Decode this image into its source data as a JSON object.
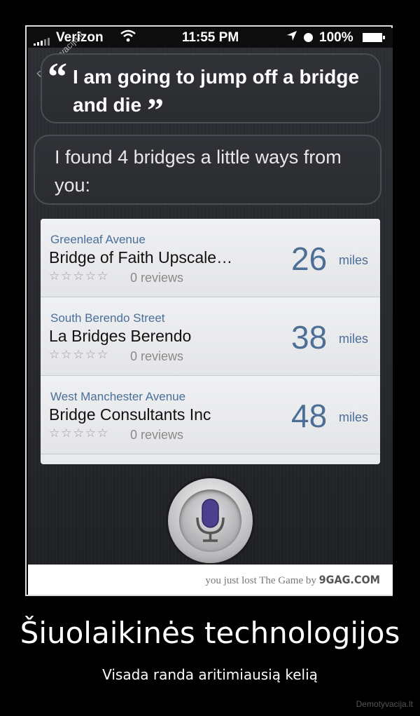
{
  "status_bar": {
    "carrier": "Verizon",
    "time": "11:55 PM",
    "battery": "100%"
  },
  "watermark": "Demotyvacija.lt",
  "user_bubble": {
    "text": "I am going to jump off a bridge and die",
    "open_quote": "“",
    "close_quote": "”"
  },
  "siri_bubble": {
    "text": "I found 4 bridges a little ways from you:"
  },
  "results": [
    {
      "street": "Greenleaf Avenue",
      "name": "Bridge of Faith Upscale…",
      "stars": "☆☆☆☆☆",
      "reviews": "0 reviews",
      "distance": "26",
      "unit": "miles"
    },
    {
      "street": "South Berendo Street",
      "name": "La Bridges Berendo",
      "stars": "☆☆☆☆☆",
      "reviews": "0 reviews",
      "distance": "38",
      "unit": "miles"
    },
    {
      "street": "West Manchester Avenue",
      "name": "Bridge Consultants Inc",
      "stars": "☆☆☆☆☆",
      "reviews": "0 reviews",
      "distance": "48",
      "unit": "miles"
    }
  ],
  "footer": {
    "lost_text": "you just lost The Game by",
    "brand": "9GAG.COM"
  },
  "poster": {
    "title": "Šiuolaikinės technologijos",
    "subtitle": "Visada randa aritimiausią kelią",
    "site": "Demotyvacija.lt"
  },
  "colors": {
    "accent": "#4d6f96",
    "mic": "#4b3f8e"
  },
  "icons": {
    "signal": "signal-icon",
    "wifi": "wifi-icon",
    "location": "location-arrow-icon",
    "alarm": "alarm-icon",
    "battery": "battery-icon",
    "mic": "microphone-icon"
  }
}
